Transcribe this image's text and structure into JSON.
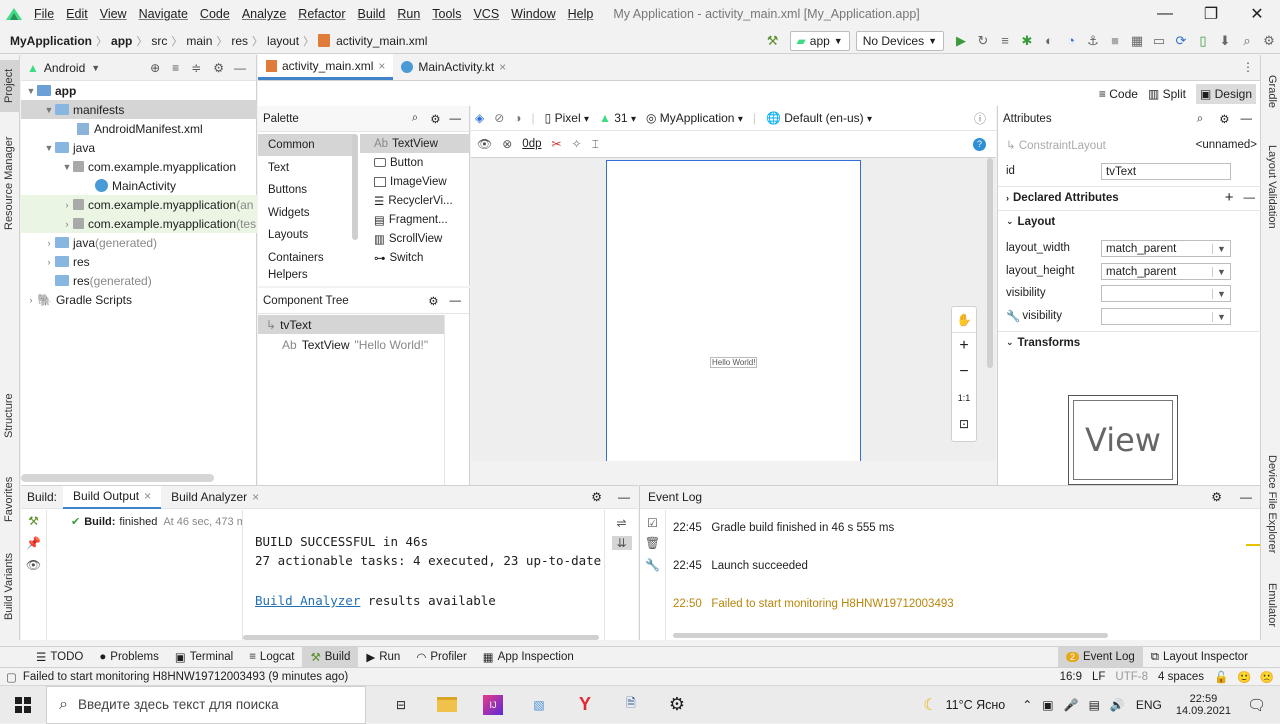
{
  "menu": {
    "items": [
      "File",
      "Edit",
      "View",
      "Navigate",
      "Code",
      "Analyze",
      "Refactor",
      "Build",
      "Run",
      "Tools",
      "VCS",
      "Window",
      "Help"
    ],
    "window_title": "My Application - activity_main.xml [My_Application.app]"
  },
  "nav": {
    "crumbs": [
      "MyApplication",
      "app",
      "src",
      "main",
      "res",
      "layout",
      "activity_main.xml"
    ],
    "run_config": "app",
    "device": "No Devices"
  },
  "left_stripe": {
    "project": "Project",
    "resource_manager": "Resource Manager",
    "structure": "Structure",
    "favorites": "Favorites",
    "build_variants": "Build Variants"
  },
  "right_stripe": {
    "gradle": "Gradle",
    "layout_validation": "Layout Validation",
    "device_file_explorer": "Device File Explorer",
    "emulator": "Emulator"
  },
  "project": {
    "view_selector": "Android",
    "tree": [
      {
        "label": "app",
        "suffix": ""
      },
      {
        "label": "manifests",
        "suffix": ""
      },
      {
        "label": "AndroidManifest.xml",
        "suffix": ""
      },
      {
        "label": "java",
        "suffix": ""
      },
      {
        "label": "com.example.myapplication",
        "suffix": ""
      },
      {
        "label": "MainActivity",
        "suffix": ""
      },
      {
        "label": "com.example.myapplication",
        "suffix": " (an"
      },
      {
        "label": "com.example.myapplication",
        "suffix": " (tes"
      },
      {
        "label": "java",
        "suffix": " (generated)"
      },
      {
        "label": "res",
        "suffix": ""
      },
      {
        "label": "res",
        "suffix": " (generated)"
      },
      {
        "label": "Gradle Scripts",
        "suffix": ""
      }
    ]
  },
  "editor": {
    "tabs": [
      "activity_main.xml",
      "MainActivity.kt"
    ],
    "modes": [
      "Code",
      "Split",
      "Design"
    ]
  },
  "palette": {
    "title": "Palette",
    "categories": [
      "Common",
      "Text",
      "Buttons",
      "Widgets",
      "Layouts",
      "Containers",
      "Helpers"
    ],
    "items": [
      "TextView",
      "Button",
      "ImageView",
      "RecyclerVi...",
      "Fragment...",
      "ScrollView",
      "Switch"
    ]
  },
  "component_tree": {
    "title": "Component Tree",
    "root": "tvText",
    "child_type": "TextView",
    "child_text": "\"Hello World!\""
  },
  "design_toolbar": {
    "device": "Pixel",
    "api": "31",
    "theme": "MyApplication",
    "locale": "Default (en-us)",
    "margin": "0dp"
  },
  "canvas": {
    "hello": "Hello World!",
    "zoom_fit": "1:1"
  },
  "attributes": {
    "title": "Attributes",
    "class_name": "ConstraintLayout",
    "unnamed": "<unnamed>",
    "id_label": "id",
    "id_value": "tvText",
    "declared": "Declared Attributes",
    "layout": "Layout",
    "layout_width_label": "layout_width",
    "layout_width_value": "match_parent",
    "layout_height_label": "layout_height",
    "layout_height_value": "match_parent",
    "visibility_label": "visibility",
    "visibility_tools_label": "visibility",
    "transforms": "Transforms",
    "view_preview": "View"
  },
  "build": {
    "label": "Build:",
    "tab_output": "Build Output",
    "tab_analyzer": "Build Analyzer",
    "status_bold": "Build:",
    "status_rest": " finished",
    "time": "At 46 sec, 473 ms",
    "line1": "BUILD SUCCESSFUL in 46s",
    "line2": "27 actionable tasks: 4 executed, 23 up-to-date",
    "link": "Build Analyzer",
    "line3_rest": " results available"
  },
  "event_log": {
    "title": "Event Log",
    "entries": [
      {
        "time": "22:45",
        "text": "Gradle build finished in 46 s 555 ms",
        "color": "#1e1e1e"
      },
      {
        "time": "22:45",
        "text": "Launch succeeded",
        "color": "#1e1e1e"
      },
      {
        "time": "22:50",
        "text": "Failed to start monitoring H8HNW19712003493",
        "color": "#b8860b"
      }
    ]
  },
  "toolwindows": {
    "todo": "TODO",
    "problems": "Problems",
    "terminal": "Terminal",
    "logcat": "Logcat",
    "build": "Build",
    "run": "Run",
    "profiler": "Profiler",
    "app_inspection": "App Inspection",
    "event_log_count": "2",
    "event_log": "Event Log",
    "layout_inspector": "Layout Inspector"
  },
  "status": {
    "message": "Failed to start monitoring H8HNW19712003493 (9 minutes ago)",
    "position": "16:9",
    "line_sep": "LF",
    "encoding": "UTF-8",
    "indent": "4 spaces"
  },
  "taskbar": {
    "search_placeholder": "Введите здесь текст для поиска",
    "weather": "11°C  Ясно",
    "lang": "ENG",
    "time": "22:59",
    "date": "14.09.2021"
  },
  "colors": {
    "accent": "#4083c9",
    "android_green": "#3ddc84",
    "warning": "#b8860b",
    "link": "#2470b3"
  }
}
